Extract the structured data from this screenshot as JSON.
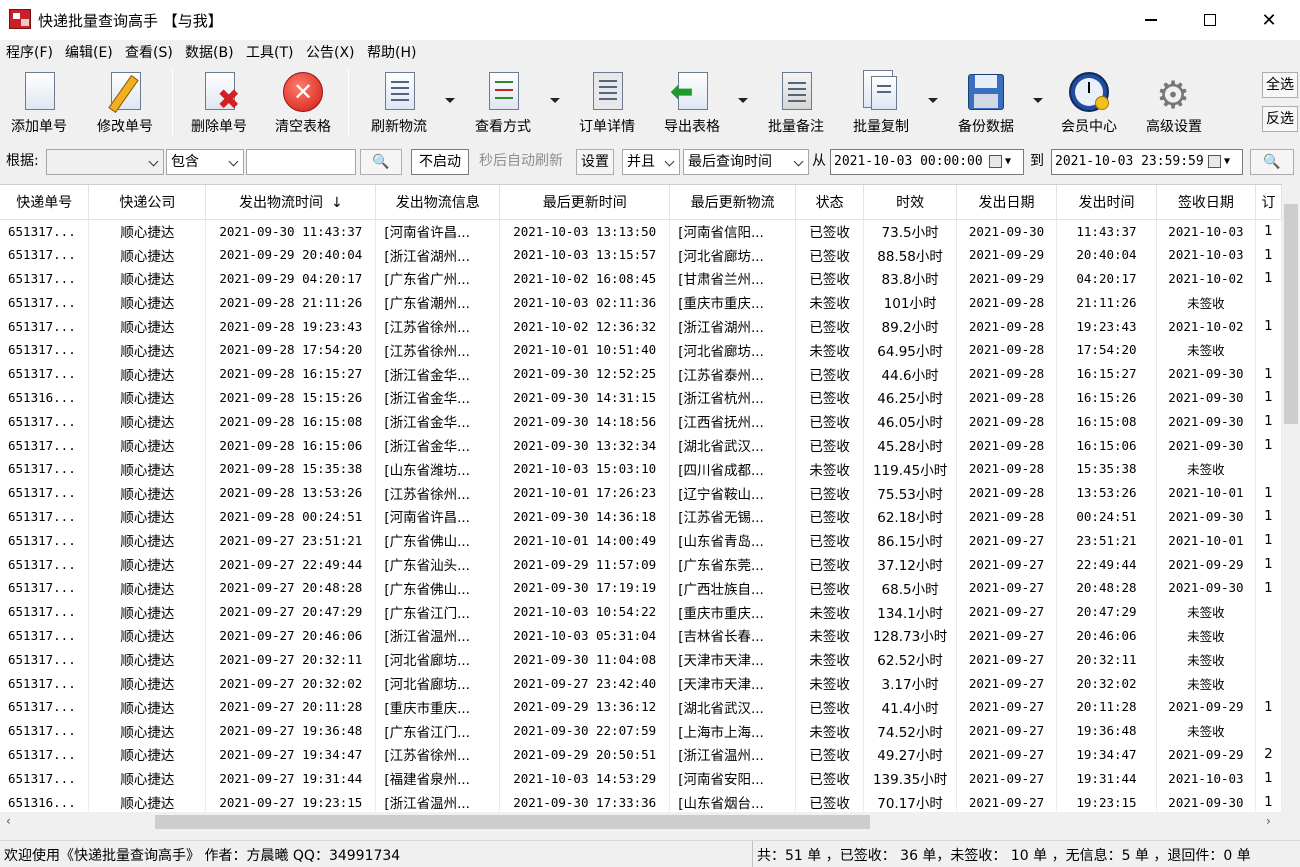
{
  "window": {
    "title": "快递批量查询高手 【与我】"
  },
  "menu": [
    "程序(F)",
    "编辑(E)",
    "查看(S)",
    "数据(B)",
    "工具(T)",
    "公告(X)",
    "帮助(H)"
  ],
  "toolbar": {
    "add": "添加单号",
    "edit": "修改单号",
    "delete": "删除单号",
    "clear": "清空表格",
    "refresh": "刷新物流",
    "view_mode": "查看方式",
    "order_detail": "订单详情",
    "export": "导出表格",
    "batch_note": "批量备注",
    "batch_copy": "批量复制",
    "backup": "备份数据",
    "member": "会员中心",
    "advanced": "高级设置",
    "select_all": "全选",
    "invert": "反选"
  },
  "filter": {
    "by_label": "根据:",
    "by_value": "",
    "match": "包含",
    "keyword": "",
    "auto_btn": "不启动",
    "auto_text": "秒后自动刷新",
    "settings": "设置",
    "logic": "并且",
    "time_field": "最后查询时间",
    "from_label": "从",
    "from": "2021-10-03 00:00:00",
    "to_label": "到",
    "to": "2021-10-03 23:59:59"
  },
  "table": {
    "headers": [
      "快递单号",
      "快递公司",
      "发出物流时间",
      "发出物流信息",
      "最后更新时间",
      "最后更新物流",
      "状态",
      "时效",
      "发出日期",
      "发出时间",
      "签收日期",
      "订"
    ],
    "sort_icon": "↓",
    "rows": [
      [
        "651317...",
        "顺心捷达",
        "2021-09-30 11:43:37",
        "[河南省许昌...",
        "2021-10-03 13:13:50",
        "[河南省信阳...",
        "已签收",
        "73.5小时",
        "2021-09-30",
        "11:43:37",
        "2021-10-03",
        "1"
      ],
      [
        "651317...",
        "顺心捷达",
        "2021-09-29 20:40:04",
        "[浙江省湖州...",
        "2021-10-03 13:15:57",
        "[河北省廊坊...",
        "已签收",
        "88.58小时",
        "2021-09-29",
        "20:40:04",
        "2021-10-03",
        "1"
      ],
      [
        "651317...",
        "顺心捷达",
        "2021-09-29 04:20:17",
        "[广东省广州...",
        "2021-10-02 16:08:45",
        "[甘肃省兰州...",
        "已签收",
        "83.8小时",
        "2021-09-29",
        "04:20:17",
        "2021-10-02",
        "1"
      ],
      [
        "651317...",
        "顺心捷达",
        "2021-09-28 21:11:26",
        "[广东省潮州...",
        "2021-10-03 02:11:36",
        "[重庆市重庆...",
        "未签收",
        "101小时",
        "2021-09-28",
        "21:11:26",
        "未签收",
        ""
      ],
      [
        "651317...",
        "顺心捷达",
        "2021-09-28 19:23:43",
        "[江苏省徐州...",
        "2021-10-02 12:36:32",
        "[浙江省湖州...",
        "已签收",
        "89.2小时",
        "2021-09-28",
        "19:23:43",
        "2021-10-02",
        "1"
      ],
      [
        "651317...",
        "顺心捷达",
        "2021-09-28 17:54:20",
        "[江苏省徐州...",
        "2021-10-01 10:51:40",
        "[河北省廊坊...",
        "未签收",
        "64.95小时",
        "2021-09-28",
        "17:54:20",
        "未签收",
        ""
      ],
      [
        "651317...",
        "顺心捷达",
        "2021-09-28 16:15:27",
        "[浙江省金华...",
        "2021-09-30 12:52:25",
        "[江苏省泰州...",
        "已签收",
        "44.6小时",
        "2021-09-28",
        "16:15:27",
        "2021-09-30",
        "1"
      ],
      [
        "651316...",
        "顺心捷达",
        "2021-09-28 15:15:26",
        "[浙江省金华...",
        "2021-09-30 14:31:15",
        "[浙江省杭州...",
        "已签收",
        "46.25小时",
        "2021-09-28",
        "16:15:26",
        "2021-09-30",
        "1"
      ],
      [
        "651317...",
        "顺心捷达",
        "2021-09-28 16:15:08",
        "[浙江省金华...",
        "2021-09-30 14:18:56",
        "[江西省抚州...",
        "已签收",
        "46.05小时",
        "2021-09-28",
        "16:15:08",
        "2021-09-30",
        "1"
      ],
      [
        "651317...",
        "顺心捷达",
        "2021-09-28 16:15:06",
        "[浙江省金华...",
        "2021-09-30 13:32:34",
        "[湖北省武汉...",
        "已签收",
        "45.28小时",
        "2021-09-28",
        "16:15:06",
        "2021-09-30",
        "1"
      ],
      [
        "651317...",
        "顺心捷达",
        "2021-09-28 15:35:38",
        "[山东省潍坊...",
        "2021-10-03 15:03:10",
        "[四川省成都...",
        "未签收",
        "119.45小时",
        "2021-09-28",
        "15:35:38",
        "未签收",
        ""
      ],
      [
        "651317...",
        "顺心捷达",
        "2021-09-28 13:53:26",
        "[江苏省徐州...",
        "2021-10-01 17:26:23",
        "[辽宁省鞍山...",
        "已签收",
        "75.53小时",
        "2021-09-28",
        "13:53:26",
        "2021-10-01",
        "1"
      ],
      [
        "651317...",
        "顺心捷达",
        "2021-09-28 00:24:51",
        "[河南省许昌...",
        "2021-09-30 14:36:18",
        "[江苏省无锡...",
        "已签收",
        "62.18小时",
        "2021-09-28",
        "00:24:51",
        "2021-09-30",
        "1"
      ],
      [
        "651317...",
        "顺心捷达",
        "2021-09-27 23:51:21",
        "[广东省佛山...",
        "2021-10-01 14:00:49",
        "[山东省青岛...",
        "已签收",
        "86.15小时",
        "2021-09-27",
        "23:51:21",
        "2021-10-01",
        "1"
      ],
      [
        "651317...",
        "顺心捷达",
        "2021-09-27 22:49:44",
        "[广东省汕头...",
        "2021-09-29 11:57:09",
        "[广东省东莞...",
        "已签收",
        "37.12小时",
        "2021-09-27",
        "22:49:44",
        "2021-09-29",
        "1"
      ],
      [
        "651317...",
        "顺心捷达",
        "2021-09-27 20:48:28",
        "[广东省佛山...",
        "2021-09-30 17:19:19",
        "[广西壮族自...",
        "已签收",
        "68.5小时",
        "2021-09-27",
        "20:48:28",
        "2021-09-30",
        "1"
      ],
      [
        "651317...",
        "顺心捷达",
        "2021-09-27 20:47:29",
        "[广东省江门...",
        "2021-10-03 10:54:22",
        "[重庆市重庆...",
        "未签收",
        "134.1小时",
        "2021-09-27",
        "20:47:29",
        "未签收",
        ""
      ],
      [
        "651317...",
        "顺心捷达",
        "2021-09-27 20:46:06",
        "[浙江省温州...",
        "2021-10-03 05:31:04",
        "[吉林省长春...",
        "未签收",
        "128.73小时",
        "2021-09-27",
        "20:46:06",
        "未签收",
        ""
      ],
      [
        "651317...",
        "顺心捷达",
        "2021-09-27 20:32:11",
        "[河北省廊坊...",
        "2021-09-30 11:04:08",
        "[天津市天津...",
        "未签收",
        "62.52小时",
        "2021-09-27",
        "20:32:11",
        "未签收",
        ""
      ],
      [
        "651317...",
        "顺心捷达",
        "2021-09-27 20:32:02",
        "[河北省廊坊...",
        "2021-09-27 23:42:40",
        "[天津市天津...",
        "未签收",
        "3.17小时",
        "2021-09-27",
        "20:32:02",
        "未签收",
        ""
      ],
      [
        "651317...",
        "顺心捷达",
        "2021-09-27 20:11:28",
        "[重庆市重庆...",
        "2021-09-29 13:36:12",
        "[湖北省武汉...",
        "已签收",
        "41.4小时",
        "2021-09-27",
        "20:11:28",
        "2021-09-29",
        "1"
      ],
      [
        "651317...",
        "顺心捷达",
        "2021-09-27 19:36:48",
        "[广东省江门...",
        "2021-09-30 22:07:59",
        "[上海市上海...",
        "未签收",
        "74.52小时",
        "2021-09-27",
        "19:36:48",
        "未签收",
        ""
      ],
      [
        "651317...",
        "顺心捷达",
        "2021-09-27 19:34:47",
        "[江苏省徐州...",
        "2021-09-29 20:50:51",
        "[浙江省温州...",
        "已签收",
        "49.27小时",
        "2021-09-27",
        "19:34:47",
        "2021-09-29",
        "2"
      ],
      [
        "651317...",
        "顺心捷达",
        "2021-09-27 19:31:44",
        "[福建省泉州...",
        "2021-10-03 14:53:29",
        "[河南省安阳...",
        "已签收",
        "139.35小时",
        "2021-09-27",
        "19:31:44",
        "2021-10-03",
        "1"
      ],
      [
        "651316...",
        "顺心捷达",
        "2021-09-27 19:23:15",
        "[浙江省温州...",
        "2021-09-30 17:33:36",
        "[山东省烟台...",
        "已签收",
        "70.17小时",
        "2021-09-27",
        "19:23:15",
        "2021-09-30",
        "1"
      ]
    ]
  },
  "status": {
    "welcome": "欢迎使用《快递批量查询高手》 作者：方晨曦  QQ：34991734",
    "summary": "共：51 单 ，已签收： 36 单，未签收： 10 单 ，无信息：5 单 ，退回件：0 单"
  }
}
